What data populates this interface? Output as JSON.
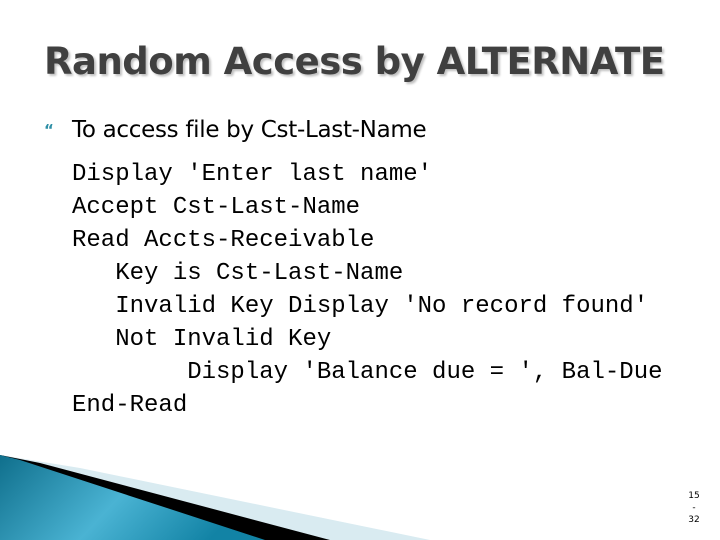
{
  "slide": {
    "title": "Random Access by ALTERNATE",
    "bullet": {
      "icon": "teal-arrow-bullet-icon",
      "glyph": "“",
      "text": "To access file by Cst-Last-Name"
    },
    "code_lines": [
      "Display 'Enter last name'",
      "Accept Cst-Last-Name",
      "Read Accts-Receivable",
      "   Key is Cst-Last-Name",
      "   Invalid Key Display 'No record found'",
      "   Not Invalid Key",
      "        Display 'Balance due = ', Bal-Due",
      "End-Read"
    ],
    "slide_number": {
      "current": "15",
      "separator": "-",
      "total": "32"
    }
  },
  "colors": {
    "title": "#404040",
    "accent": "#2e8fa6",
    "wave_dark": "#0f6f8c",
    "wave_light": "#4ab3d3",
    "wave_shadow": "#000000",
    "wave_pale": "#d9ebf1"
  }
}
